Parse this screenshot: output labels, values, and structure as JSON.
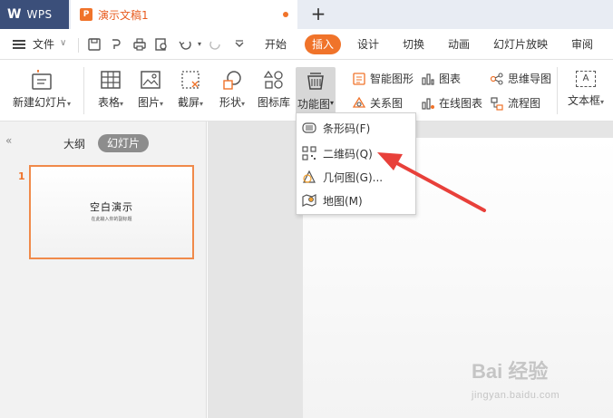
{
  "titlebar": {
    "app_logo": "W",
    "app_name": "WPS",
    "doc_icon": "P",
    "doc_title": "演示文稿1",
    "new_tab_symbol": "+"
  },
  "menu": {
    "file": "文件",
    "file_chevron": "∨",
    "tabs": [
      "开始",
      "插入",
      "设计",
      "切换",
      "动画",
      "幻灯片放映",
      "审阅"
    ],
    "active_tab": "插入"
  },
  "ribbon": {
    "new_slide": "新建幻灯片",
    "table": "表格",
    "picture": "图片",
    "screenshot": "截屏",
    "shape": "形状",
    "icon_lib": "图标库",
    "function_chart": "功能图",
    "smart_shape": "智能图形",
    "relation_chart": "关系图",
    "chart": "图表",
    "online_chart": "在线图表",
    "mind_map": "思维导图",
    "flow_chart": "流程图",
    "text_box": "文本框",
    "dropdown_arrow": "▾"
  },
  "dropdown": {
    "items": [
      {
        "label": "条形码(F)",
        "icon": "barcode-icon"
      },
      {
        "label": "二维码(Q)",
        "icon": "qrcode-icon"
      },
      {
        "label": "几何图(G)...",
        "icon": "geometry-icon"
      },
      {
        "label": "地图(M)",
        "icon": "map-icon"
      }
    ]
  },
  "panel": {
    "collapse_symbol": "«",
    "tab_outline": "大纲",
    "tab_slides": "幻灯片",
    "slide_number": "1",
    "slide_title": "空白演示",
    "slide_subtitle": "在此输入你的副标题"
  },
  "watermark": {
    "main": "Bai 经验",
    "sub": "jingyan.baidu.com"
  },
  "colors": {
    "accent": "#f0732a",
    "wps_tab": "#3b4f7a",
    "arrow": "#e8403a"
  }
}
